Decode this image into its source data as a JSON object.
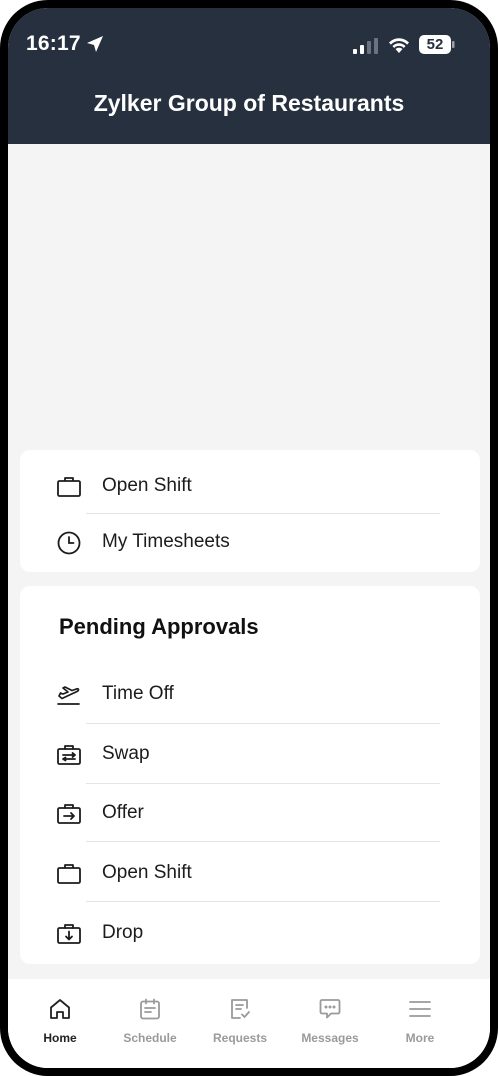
{
  "status_bar": {
    "time": "16:17",
    "battery": "52"
  },
  "header": {
    "title": "Zylker Group of Restaurants"
  },
  "quick_links": [
    {
      "label": "Open Shift",
      "icon": "briefcase-icon"
    },
    {
      "label": "My Timesheets",
      "icon": "clock-icon"
    }
  ],
  "pending_approvals": {
    "title": "Pending Approvals",
    "items": [
      {
        "label": "Time Off",
        "icon": "airplane-icon"
      },
      {
        "label": "Swap",
        "icon": "swap-icon"
      },
      {
        "label": "Offer",
        "icon": "offer-icon"
      },
      {
        "label": "Open Shift",
        "icon": "briefcase-icon"
      },
      {
        "label": "Drop",
        "icon": "drop-icon"
      }
    ]
  },
  "tabs": [
    {
      "label": "Home",
      "icon": "home-icon",
      "active": true
    },
    {
      "label": "Schedule",
      "icon": "calendar-icon",
      "active": false
    },
    {
      "label": "Requests",
      "icon": "requests-icon",
      "active": false
    },
    {
      "label": "Messages",
      "icon": "chat-icon",
      "active": false
    },
    {
      "label": "More",
      "icon": "menu-icon",
      "active": false
    }
  ],
  "colors": {
    "header_bg": "#27303f",
    "page_bg": "#f4f4f4",
    "card_bg": "#ffffff",
    "active_tab": "#222222",
    "inactive_tab": "#9a9a9a"
  }
}
